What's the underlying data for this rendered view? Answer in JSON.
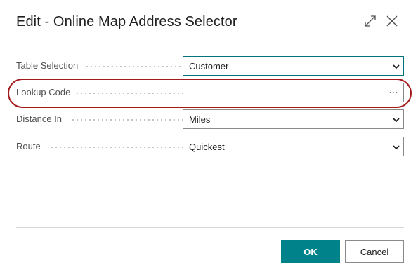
{
  "dialog": {
    "title": "Edit - Online Map Address Selector"
  },
  "header_icons": {
    "expand": "expand-icon",
    "close": "close-icon"
  },
  "fields": {
    "table_selection": {
      "label": "Table Selection",
      "value": "Customer"
    },
    "lookup_code": {
      "label": "Lookup Code",
      "value": "",
      "lookup_glyph": "···"
    },
    "distance_in": {
      "label": "Distance In",
      "value": "Miles"
    },
    "route": {
      "label": "Route",
      "value": "Quickest"
    }
  },
  "buttons": {
    "ok_label": "OK",
    "cancel_label": "Cancel"
  },
  "colors": {
    "accent": "#00828a",
    "highlight_ring": "#a21a1c"
  }
}
